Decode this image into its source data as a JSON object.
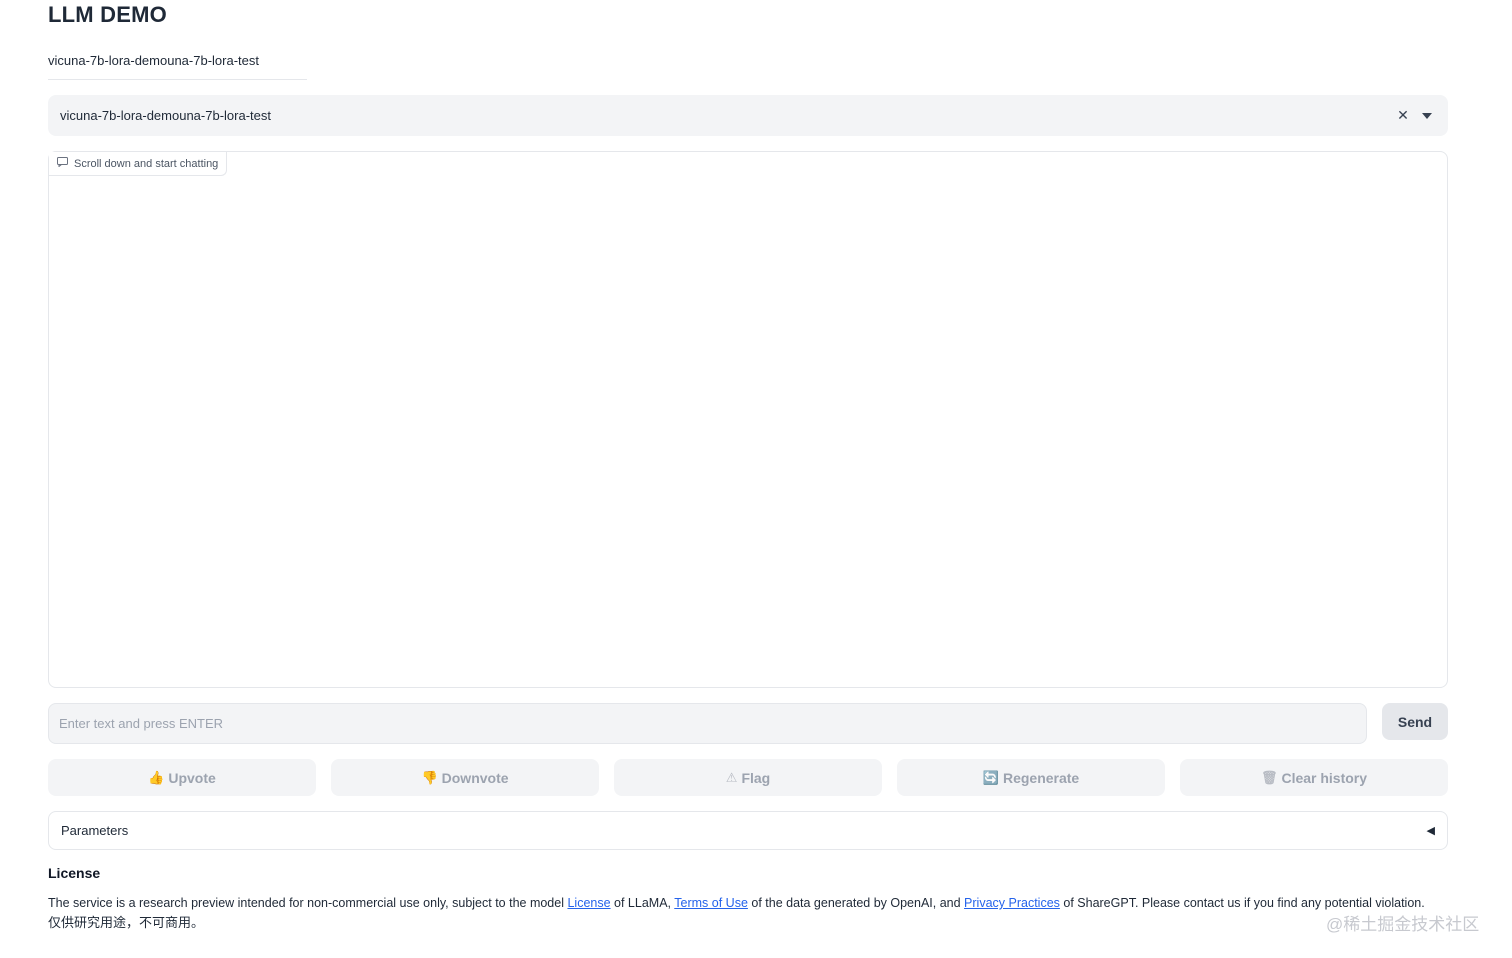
{
  "header": {
    "title": "LLM DEMO"
  },
  "tab": {
    "label": "vicuna-7b-lora-demouna-7b-lora-test"
  },
  "model_select": {
    "value": "vicuna-7b-lora-demouna-7b-lora-test",
    "clear_icon": "close-icon",
    "caret_icon": "chevron-down-icon"
  },
  "chatbot": {
    "label": "Scroll down and start chatting",
    "icon": "chat-icon"
  },
  "composer": {
    "placeholder": "Enter text and press ENTER",
    "send_label": "Send"
  },
  "actions": [
    {
      "icon": "👍",
      "label": "Upvote"
    },
    {
      "icon": "👎",
      "label": "Downvote"
    },
    {
      "icon": "⚠",
      "label": "Flag"
    },
    {
      "icon": "🔄",
      "label": "Regenerate"
    },
    {
      "icon": "🗑",
      "label": "Clear history"
    }
  ],
  "parameters": {
    "label": "Parameters",
    "arrow": "◀"
  },
  "license": {
    "title": "License",
    "text_1": "The service is a research preview intended for non-commercial use only, subject to the model ",
    "link_1": "License",
    "text_2": " of LLaMA, ",
    "link_2": "Terms of Use",
    "text_3": " of the data generated by OpenAI, and ",
    "link_3": "Privacy Practices",
    "text_4": " of ShareGPT. Please contact us if you find any potential violation.",
    "cn": "仅供研究用途，不可商用。"
  },
  "watermark": "@稀土掘金技术社区",
  "colors": {
    "input_bg": "#f3f4f6",
    "border": "#e5e7eb",
    "link": "#2563eb",
    "muted_text": "#9ca3af"
  }
}
